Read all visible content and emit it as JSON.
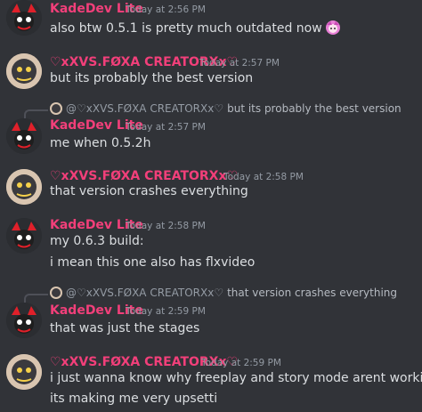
{
  "colors": {
    "kade_name": "#f23f7a",
    "xxvs_name": "#f23f7a",
    "text": "#dbdee1",
    "timestamp": "#949ba4",
    "background": "#313338"
  },
  "messages": [
    {
      "author": "KadeDev Lite",
      "timestamp": "Today at 2:56 PM",
      "lines": [
        "also btw 0.5.1 is pretty much outdated now"
      ],
      "emoji": "anime-girl-emoji"
    },
    {
      "author": "♡xXVS.FØXA CREATORXx♡",
      "timestamp": "Today at 2:57 PM",
      "lines": [
        "but its probably the best version"
      ]
    },
    {
      "reply_to": {
        "author": "@♡xXVS.FØXA CREATORXx♡",
        "text": "but its probably the best version"
      },
      "author": "KadeDev Lite",
      "timestamp": "Today at 2:57 PM",
      "lines": [
        "me when 0.5.2h"
      ]
    },
    {
      "author": "♡xXVS.FØXA CREATORXx♡",
      "timestamp": "Today at 2:58 PM",
      "lines": [
        "that version crashes everything"
      ]
    },
    {
      "author": "KadeDev Lite",
      "timestamp": "Today at 2:58 PM",
      "lines": [
        "my 0.6.3 build:",
        "i mean this one also has flxvideo"
      ]
    },
    {
      "reply_to": {
        "author": "@♡xXVS.FØXA CREATORXx♡",
        "text": "that version crashes everything"
      },
      "author": "KadeDev Lite",
      "timestamp": "Today at 2:59 PM",
      "lines": [
        "that was just the stages"
      ]
    },
    {
      "author": "♡xXVS.FØXA CREATORXx♡",
      "timestamp": "Today at 2:59 PM",
      "lines": [
        "i just wanna know why freeplay and story mode arent working",
        "its making me very upsetti"
      ]
    }
  ]
}
